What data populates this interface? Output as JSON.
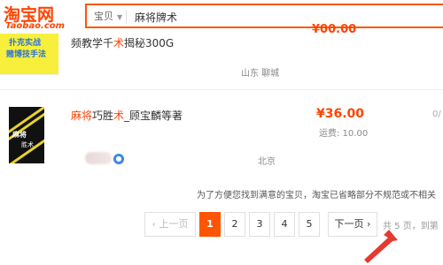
{
  "header": {
    "logo_cn": "淘宝网",
    "logo_en": "Taobao.com",
    "search_category": "宝贝",
    "search_query": "麻将牌术"
  },
  "item1": {
    "thumb_line1": "扑克实战",
    "thumb_line2": "赌博技手法",
    "title_prefix": "频教学千",
    "title_highlight": "术",
    "title_suffix": "揭秘300G",
    "price_partial": "¥00.00",
    "location": "山东 聊城"
  },
  "item2": {
    "thumb_text1": "麻将",
    "thumb_text2": "胜术",
    "title_hl1": "麻将",
    "title_mid": "巧胜",
    "title_hl2": "术",
    "title_suffix": "_顾宝麟等著",
    "price": "¥36.00",
    "shipping": "运费: 10.00",
    "cut_text": "0/",
    "location": "北京"
  },
  "notice": "为了方便您找到满意的宝贝，淘宝已省略部分不规范或不相关",
  "pagination": {
    "prev": "‹ 上一页",
    "pages": [
      "1",
      "2",
      "3",
      "4",
      "5"
    ],
    "next": "下一页 ›",
    "info": "共 5 页，到第",
    "current": "1"
  },
  "colors": {
    "accent": "#ff5500",
    "price": "#ff4400"
  }
}
